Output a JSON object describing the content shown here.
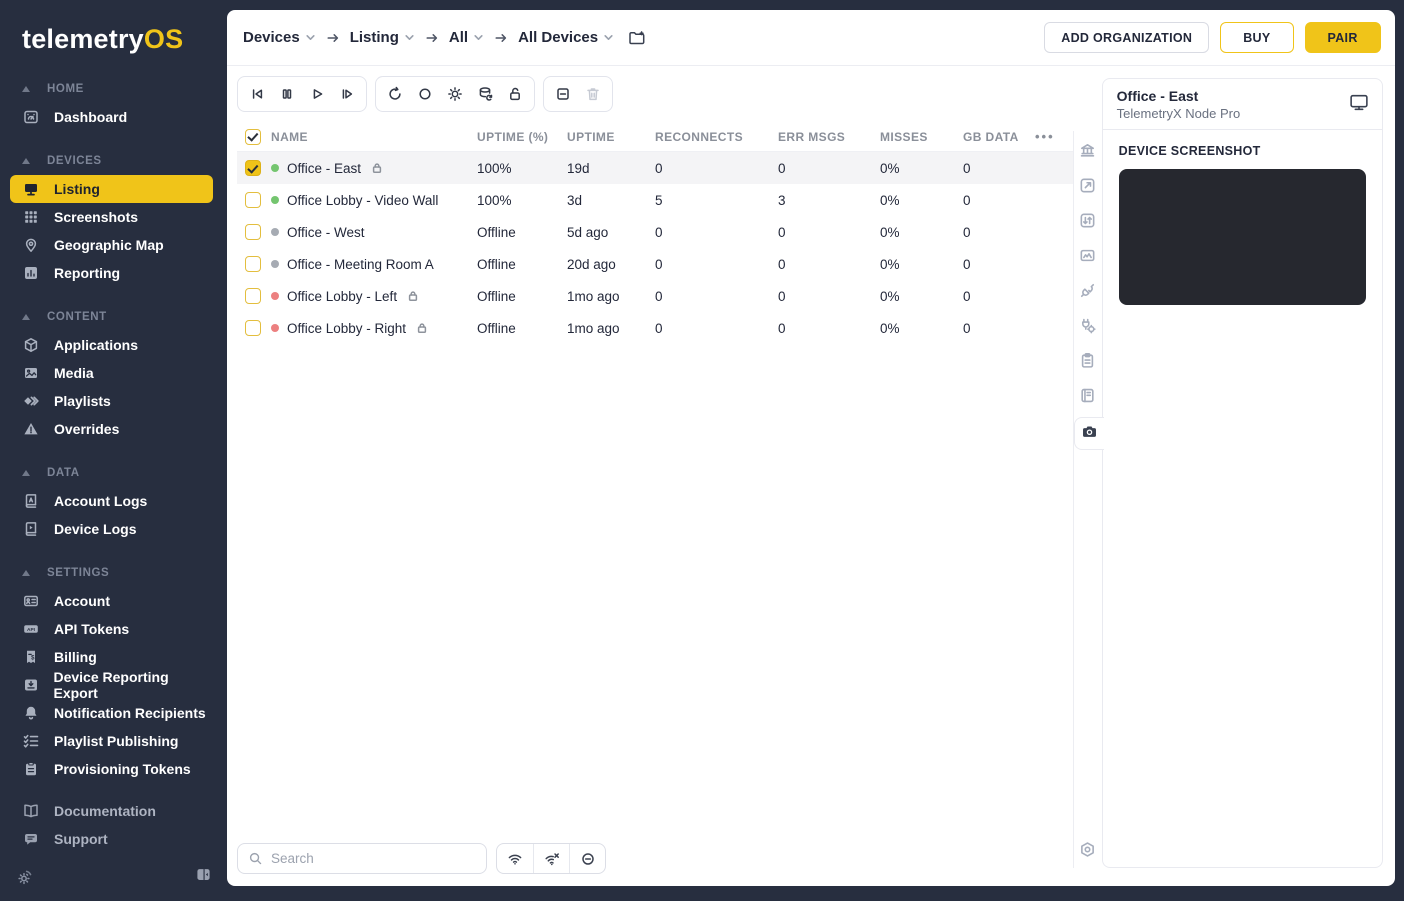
{
  "brand": {
    "name_primary": "telemetry",
    "name_accent": "OS"
  },
  "colors": {
    "accent_yellow": "#F0C419",
    "sidebar_bg": "#272E3F",
    "status_online": "#74C56F",
    "status_offline": "#A6ABB3",
    "status_error": "#EC8080",
    "screenshot_bg": "#26282F",
    "selected_row_bg": "#F4F4F6"
  },
  "sidebar": {
    "sections": [
      {
        "label": "HOME",
        "items": [
          {
            "label": "Dashboard",
            "icon": "dashboard-gauge-icon"
          }
        ]
      },
      {
        "label": "DEVICES",
        "items": [
          {
            "label": "Listing",
            "icon": "monitor-icon",
            "active": true
          },
          {
            "label": "Screenshots",
            "icon": "grid-icon"
          },
          {
            "label": "Geographic Map",
            "icon": "map-pin-icon"
          },
          {
            "label": "Reporting",
            "icon": "bar-chart-icon"
          }
        ]
      },
      {
        "label": "CONTENT",
        "items": [
          {
            "label": "Applications",
            "icon": "cube-icon"
          },
          {
            "label": "Media",
            "icon": "image-icon"
          },
          {
            "label": "Playlists",
            "icon": "playlist-icon"
          },
          {
            "label": "Overrides",
            "icon": "warning-icon"
          }
        ]
      },
      {
        "label": "DATA",
        "items": [
          {
            "label": "Account Logs",
            "icon": "book-a-icon"
          },
          {
            "label": "Device Logs",
            "icon": "book-play-icon"
          }
        ]
      },
      {
        "label": "SETTINGS",
        "items": [
          {
            "label": "Account",
            "icon": "id-card-icon"
          },
          {
            "label": "API Tokens",
            "icon": "api-badge-icon"
          },
          {
            "label": "Billing",
            "icon": "receipt-icon"
          },
          {
            "label": "Device Reporting Export",
            "icon": "download-icon"
          },
          {
            "label": "Notification Recipients",
            "icon": "bell-icon"
          },
          {
            "label": "Playlist Publishing",
            "icon": "checklist-icon"
          },
          {
            "label": "Provisioning Tokens",
            "icon": "clipboard-icon"
          }
        ]
      }
    ],
    "footer_items": [
      {
        "label": "Documentation",
        "icon": "open-book-icon"
      },
      {
        "label": "Support",
        "icon": "chat-icon"
      }
    ],
    "bottom_icons": [
      "theme-toggle-icon",
      "collapse-sidebar-icon"
    ]
  },
  "header": {
    "breadcrumbs": [
      {
        "label": "Devices"
      },
      {
        "label": "Listing"
      },
      {
        "label": "All"
      },
      {
        "label": "All Devices"
      }
    ],
    "folder_icon": "folder-plus-icon",
    "actions": [
      {
        "label": "ADD ORGANIZATION",
        "style": "outline"
      },
      {
        "label": "BUY",
        "style": "outline-accent"
      },
      {
        "label": "PAIR",
        "style": "accent"
      }
    ]
  },
  "toolbar": {
    "groups": [
      [
        "skip-back-icon",
        "pause-icon",
        "play-icon",
        "skip-forward-icon"
      ],
      [
        "restart-icon",
        "circle-icon",
        "debug-icon",
        "database-sync-icon",
        "unlock-icon"
      ],
      [
        "select-none-icon",
        "trash-icon"
      ]
    ]
  },
  "table": {
    "columns": [
      "NAME",
      "UPTIME (%)",
      "UPTIME",
      "RECONNECTS",
      "ERR MSGS",
      "MISSES",
      "GB DATA"
    ],
    "more_icon": "ellipsis-icon",
    "rows": [
      {
        "name": "Office - East",
        "dot": "green",
        "checked": true,
        "selected": true,
        "locked": true,
        "uptime_pct": "100%",
        "uptime": "19d",
        "reconnects": "0",
        "err_msgs": "0",
        "misses": "0%",
        "gb_data": "0"
      },
      {
        "name": "Office Lobby - Video Wall",
        "dot": "green",
        "checked": false,
        "selected": false,
        "locked": false,
        "uptime_pct": "100%",
        "uptime": "3d",
        "reconnects": "5",
        "err_msgs": "3",
        "misses": "0%",
        "gb_data": "0"
      },
      {
        "name": "Office - West",
        "dot": "gray",
        "checked": false,
        "selected": false,
        "locked": false,
        "uptime_pct": "Offline",
        "uptime": "5d ago",
        "reconnects": "0",
        "err_msgs": "0",
        "misses": "0%",
        "gb_data": "0"
      },
      {
        "name": "Office - Meeting Room A",
        "dot": "gray",
        "checked": false,
        "selected": false,
        "locked": false,
        "uptime_pct": "Offline",
        "uptime": "20d ago",
        "reconnects": "0",
        "err_msgs": "0",
        "misses": "0%",
        "gb_data": "0"
      },
      {
        "name": "Office Lobby - Left",
        "dot": "red",
        "checked": false,
        "selected": false,
        "locked": true,
        "uptime_pct": "Offline",
        "uptime": "1mo ago",
        "reconnects": "0",
        "err_msgs": "0",
        "misses": "0%",
        "gb_data": "0"
      },
      {
        "name": "Office Lobby - Right",
        "dot": "red",
        "checked": false,
        "selected": false,
        "locked": true,
        "uptime_pct": "Offline",
        "uptime": "1mo ago",
        "reconnects": "0",
        "err_msgs": "0",
        "misses": "0%",
        "gb_data": "0"
      }
    ]
  },
  "footer": {
    "search_placeholder": "Search",
    "filter_icons": [
      "wifi-on-icon",
      "wifi-off-icon",
      "offline-circle-icon"
    ]
  },
  "rail": {
    "icons": [
      "bank-icon",
      "preview-icon",
      "sort-arrows-icon",
      "kiosk-icon",
      "plugs-icon",
      "integration-icon",
      "clipboard-icon",
      "journal-icon"
    ],
    "active_icon": "camera-icon",
    "bottom_icon": "gear-icon"
  },
  "panel": {
    "device_name": "Office - East",
    "device_model": "TelemetryX Node Pro",
    "monitor_icon": "monitor-icon",
    "section_title": "DEVICE SCREENSHOT"
  }
}
